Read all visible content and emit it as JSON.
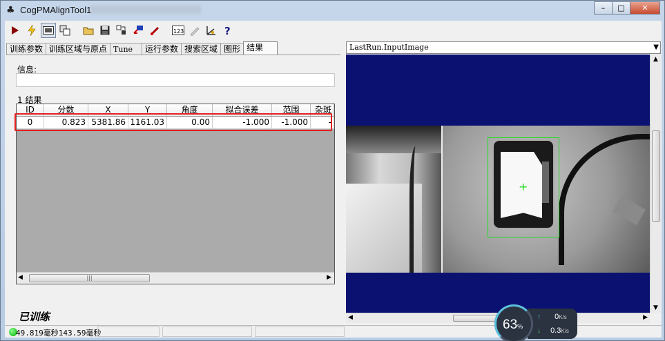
{
  "window": {
    "title": "CogPMAlignTool1",
    "controls": {
      "minimize": "–",
      "maximize": "□",
      "close": "✕"
    }
  },
  "toolbar": {
    "icons": [
      "run-icon",
      "live-icon",
      "display-toggle-icon",
      "image-source-icon",
      "open-icon",
      "save-icon",
      "reset-icon",
      "import-icon",
      "export-icon",
      "number-format-icon",
      "edit-icon",
      "train-icon",
      "help-icon"
    ]
  },
  "tabs": [
    {
      "label": "训练参数"
    },
    {
      "label": "训练区域与原点"
    },
    {
      "label": "Tune"
    },
    {
      "label": "运行参数"
    },
    {
      "label": "搜索区域"
    },
    {
      "label": "图形"
    },
    {
      "label": "结果"
    }
  ],
  "results_panel": {
    "info_label": "信息:",
    "info_value": "",
    "results_label": "1 结果",
    "columns": [
      "ID",
      "分数",
      "X",
      "Y",
      "角度",
      "拟合误差",
      "范围",
      "杂斑"
    ],
    "rows": [
      {
        "id": "0",
        "score": "0.823",
        "x": "5381.86",
        "y": "1161.03",
        "angle": "0.00",
        "fit_error": "-1.000",
        "range": "-1.000",
        "clutter": "-"
      }
    ],
    "status": "已训练"
  },
  "image_display": {
    "selected_image": "LastRun.InputImage"
  },
  "statusbar": {
    "timing": "49.819毫秒143.59毫秒"
  },
  "network": {
    "percent": "63",
    "percent_unit": "%",
    "upload": "0",
    "upload_unit": "K/s",
    "download": "0.3",
    "download_unit": "K/s"
  },
  "colors": {
    "highlight": "#e52020",
    "match_box": "#22dd22",
    "viewer_bg": "#0a1170"
  }
}
